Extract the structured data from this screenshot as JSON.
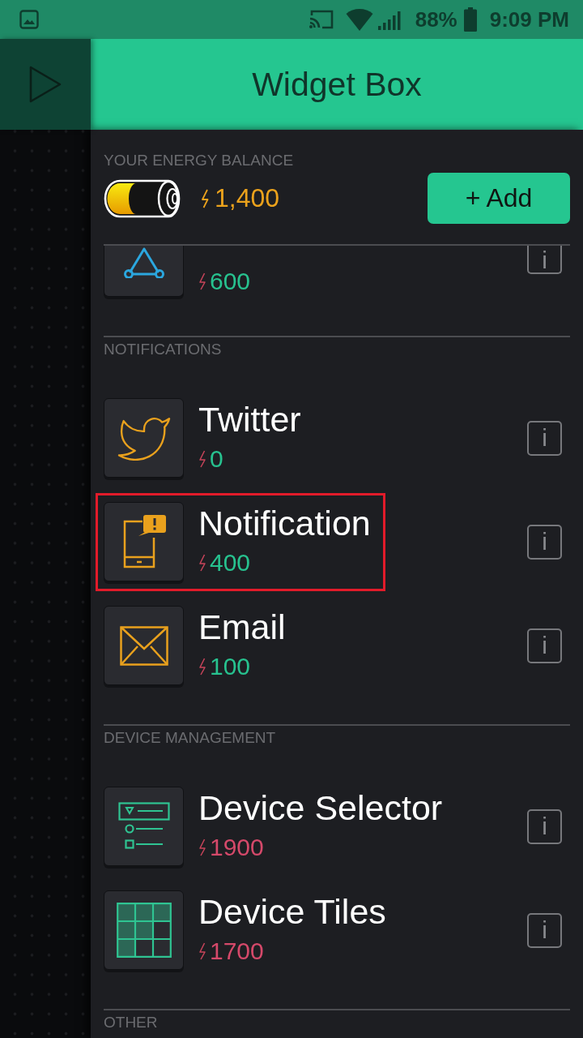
{
  "status_bar": {
    "battery": "88%",
    "time": "9:09 PM"
  },
  "header": {
    "title": "Widget Box"
  },
  "energy": {
    "label": "YOUR ENERGY BALANCE",
    "amount": "1,400",
    "add_button": "+ Add"
  },
  "sections": [
    {
      "items": [
        {
          "kind": "share",
          "color": "#2ba7df",
          "price": "600",
          "affordable": true,
          "clipped": true,
          "highlighted": false,
          "info": "i"
        }
      ]
    },
    {
      "title": "NOTIFICATIONS",
      "items": [
        {
          "name": "Twitter",
          "kind": "twitter",
          "color": "#e9a11d",
          "price": "0",
          "affordable": true,
          "clipped": false,
          "highlighted": false,
          "info": "i"
        },
        {
          "name": "Notification",
          "kind": "notification",
          "color": "#e9a11d",
          "price": "400",
          "affordable": true,
          "clipped": false,
          "highlighted": true,
          "info": "i"
        },
        {
          "name": "Email",
          "kind": "email",
          "color": "#e9a11d",
          "price": "100",
          "affordable": true,
          "clipped": false,
          "highlighted": false,
          "info": "i"
        }
      ]
    },
    {
      "title": "DEVICE MANAGEMENT",
      "items": [
        {
          "name": "Device Selector",
          "kind": "selector",
          "color": "#2fc492",
          "price": "1900",
          "affordable": false,
          "clipped": false,
          "highlighted": false,
          "info": "i"
        },
        {
          "name": "Device Tiles",
          "kind": "tiles",
          "color": "#2fc492",
          "price": "1700",
          "affordable": false,
          "clipped": false,
          "highlighted": false,
          "info": "i"
        }
      ]
    },
    {
      "title": "OTHER"
    }
  ]
}
